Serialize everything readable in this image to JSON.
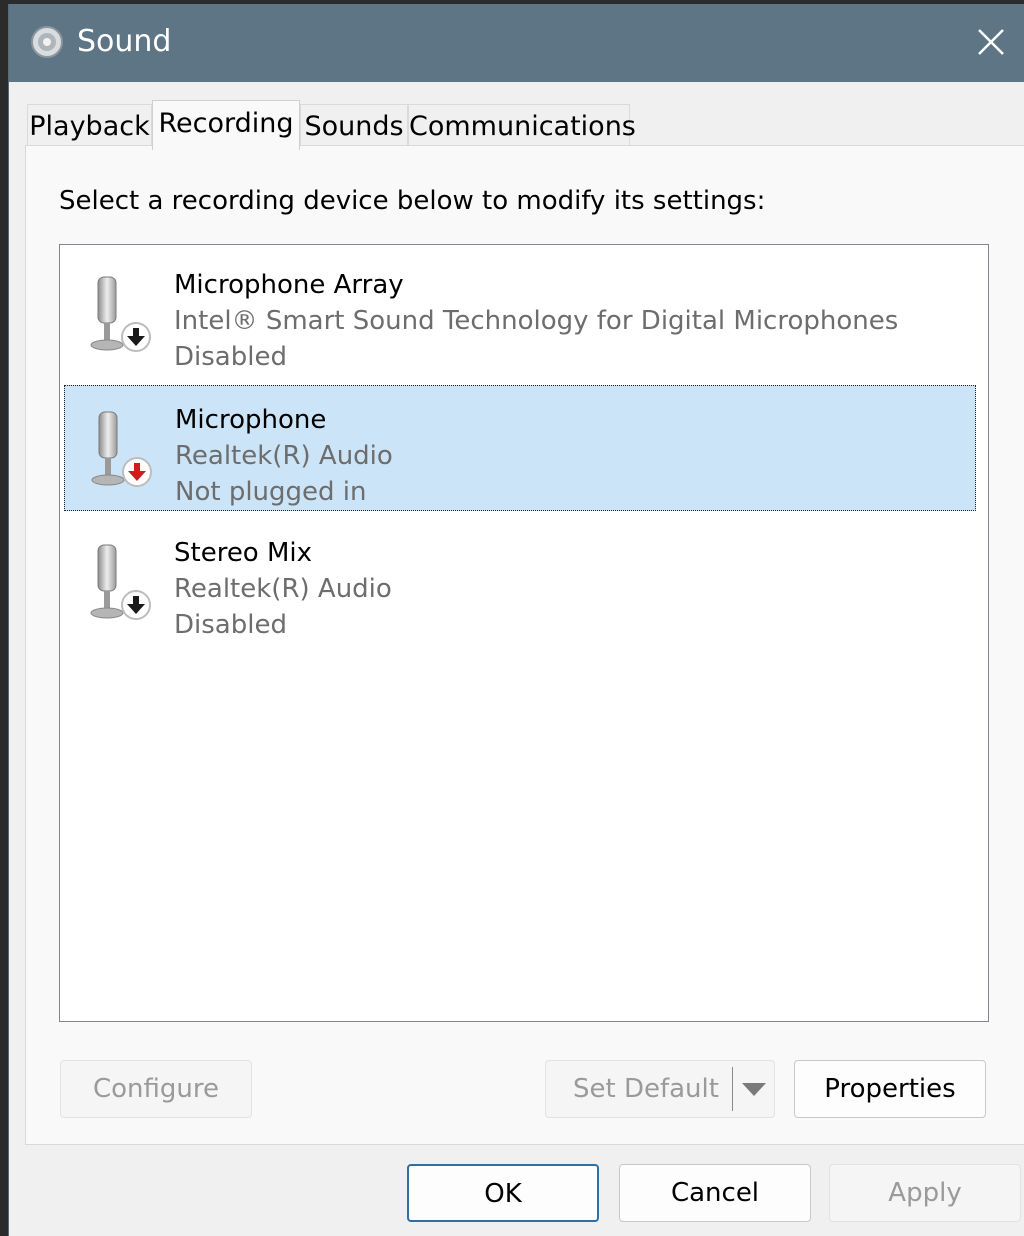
{
  "window": {
    "title": "Sound",
    "icon": "speaker-icon",
    "close_icon": "close-icon"
  },
  "tabs": [
    {
      "label": "Playback",
      "active": false
    },
    {
      "label": "Recording",
      "active": true
    },
    {
      "label": "Sounds",
      "active": false
    },
    {
      "label": "Communications",
      "active": false
    }
  ],
  "instruction": "Select a recording device below to modify its settings:",
  "devices": [
    {
      "name": "Microphone Array",
      "description": "Intel® Smart Sound Technology for Digital Microphones",
      "status": "Disabled",
      "badge": "down-arrow-icon",
      "badge_color": "#1a1a1a",
      "selected": false
    },
    {
      "name": "Microphone",
      "description": "Realtek(R) Audio",
      "status": "Not plugged in",
      "badge": "down-arrow-icon",
      "badge_color": "#d01c1c",
      "selected": true
    },
    {
      "name": "Stereo Mix",
      "description": "Realtek(R) Audio",
      "status": "Disabled",
      "badge": "down-arrow-icon",
      "badge_color": "#1a1a1a",
      "selected": false
    }
  ],
  "buttons": {
    "configure": "Configure",
    "set_default": "Set Default",
    "properties": "Properties",
    "ok": "OK",
    "cancel": "Cancel",
    "apply": "Apply"
  },
  "colors": {
    "titlebar": "#5d7584",
    "selection": "#cce4f7",
    "primary_border": "#2e6fa8"
  }
}
